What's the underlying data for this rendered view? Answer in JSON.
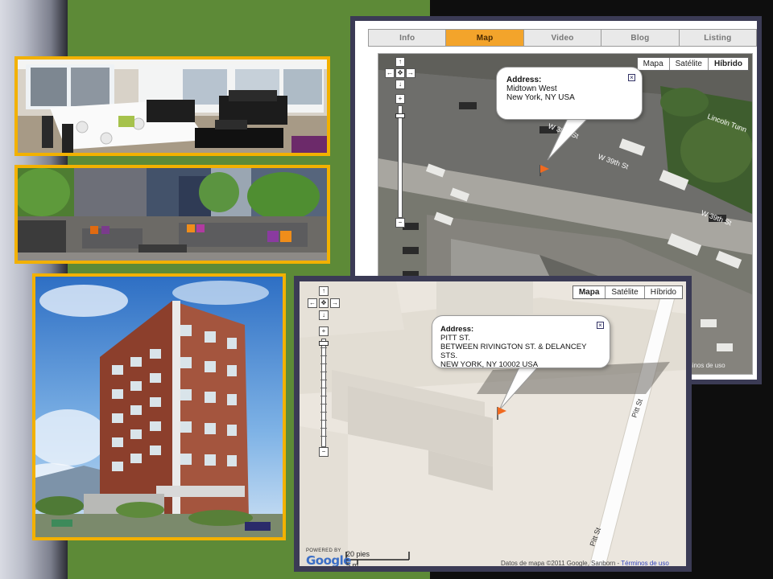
{
  "tabs": [
    {
      "label": "Info",
      "active": false
    },
    {
      "label": "Map",
      "active": true
    },
    {
      "label": "Video",
      "active": false
    },
    {
      "label": "Blog",
      "active": false
    },
    {
      "label": "Listing",
      "active": false
    }
  ],
  "top_map": {
    "map_types": [
      "Mapa",
      "Satélite",
      "Híbrido"
    ],
    "selected_type": "Híbrido",
    "info": {
      "title": "Address:",
      "line1": "Midtown West",
      "line2": "New York, NY USA"
    },
    "street_labels": [
      "W 38th St",
      "W 39th St",
      "W 39th St",
      "Lincoln Tunn"
    ],
    "legal_text": "Términos de uso"
  },
  "bottom_map": {
    "map_types": [
      "Mapa",
      "Satélite",
      "Híbrido"
    ],
    "selected_type": "Mapa",
    "info": {
      "title": "Address:",
      "line1": "PITT ST.",
      "line2": "BETWEEN RIVINGTON ST. & DELANCEY STS.",
      "line3": "NEW YORK, NY 10002 USA"
    },
    "street_labels": [
      "Pitt St",
      "Pitt St"
    ],
    "powered_by": "POWERED BY",
    "logo_text": "Google",
    "scale_top": "20 pies",
    "scale_bottom": "5 m",
    "attribution": "Datos de mapa ©2011 Google, Sanborn - ",
    "terms_link": "Términos de uso"
  },
  "colors": {
    "frame_gold": "#f2b100",
    "tab_active": "#f3a42b",
    "panel_navy": "#3b3b55",
    "green_band": "#5d8a37"
  }
}
